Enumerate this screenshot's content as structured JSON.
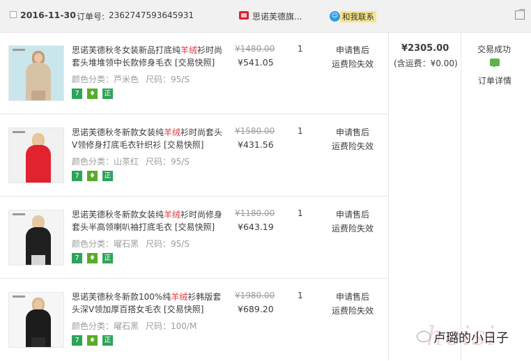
{
  "order": {
    "date": "2016-11-30",
    "order_no_label": "订单号:",
    "order_no": "2362747593645931",
    "shop_name": "思诺芙德旗...",
    "contact_label": "和我联系",
    "total": "¥2305.00",
    "shipping_note": "(含运费：¥0.00)",
    "status": "交易成功",
    "detail_link": "订单详情"
  },
  "items": [
    {
      "title_pre": "思诺芙德秋冬女装新品打底纯",
      "title_kw": "羊绒",
      "title_post": "衫时尚套头堆堆领中长款修身毛衣 [交易快照]",
      "color": "颜色分类：芦米色",
      "size": "尺码：95/S",
      "price_old": "¥1480.00",
      "price_new": "¥541.05",
      "qty": "1",
      "aftersale": "申请售后",
      "insurance": "运费险失效"
    },
    {
      "title_pre": "思诺芙德秋冬新款女装纯",
      "title_kw": "羊绒",
      "title_post": "衫时尚套头V领修身打底毛衣针织衫 [交易快照]",
      "color": "颜色分类：山茶红",
      "size": "尺码：95/S",
      "price_old": "¥1580.00",
      "price_new": "¥431.56",
      "qty": "1",
      "aftersale": "申请售后",
      "insurance": "运费险失效"
    },
    {
      "title_pre": "思诺芙德秋冬新款女装纯",
      "title_kw": "羊绒",
      "title_post": "衫时尚修身套头半高领喇叭袖打底毛衣 [交易快照]",
      "color": "颜色分类：曜石黑",
      "size": "尺码：95/S",
      "price_old": "¥1180.00",
      "price_new": "¥643.19",
      "qty": "1",
      "aftersale": "申请售后",
      "insurance": "运费险失效"
    },
    {
      "title_pre": "思诺芙德秋冬新款100%纯",
      "title_kw": "羊绒",
      "title_post": "衫韩版套头深V领加厚百搭女毛衣 [交易快照]",
      "color": "颜色分类：曜石黑",
      "size": "尺码：100/M",
      "price_old": "¥1980.00",
      "price_new": "¥689.20",
      "qty": "1",
      "aftersale": "申请售后",
      "insurance": "运费险失效"
    }
  ],
  "badges": {
    "seven": "7",
    "zheng": "正"
  },
  "watermark": {
    "text": "卢璐的小日子",
    "stamp": "heisi"
  },
  "icons": [
    "checkbox-icon",
    "shop-icon",
    "contact-icon",
    "share-icon",
    "message-icon",
    "wechat-icon"
  ],
  "colors": {
    "keyword": "#e4393c",
    "contact_bg": "#f7e58a",
    "badge_green": "#2ea35a",
    "header_bg": "#f1f1f1"
  }
}
